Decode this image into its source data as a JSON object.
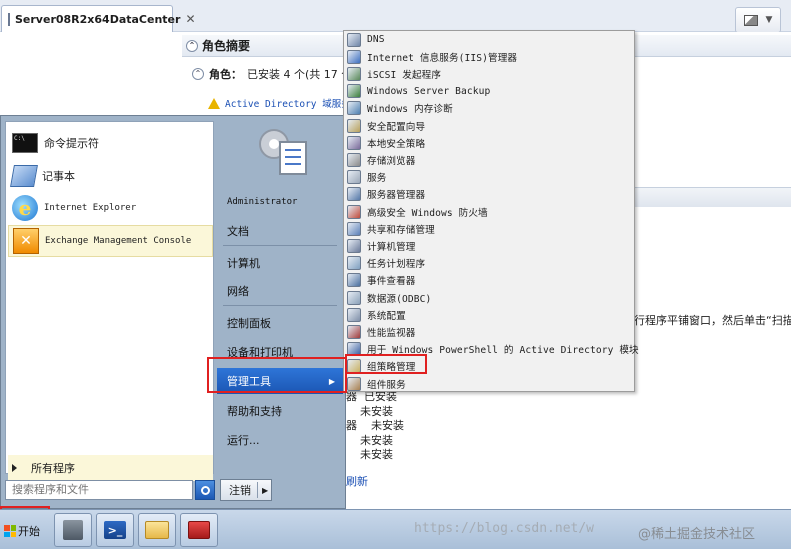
{
  "window": {
    "tab_title": "Server08R2x64DataCenter",
    "tab_close": "✕",
    "section_title": "角色摘要",
    "roles_label": "角色：",
    "roles_status": "已安装 4 个(共 17 个",
    "ad_link": "Active Directory 域服务",
    "right_text": "行程序平铺窗口，然后单击“扫描此",
    "status_lines": [
      "器  已安装",
      "    未安装",
      "器    未安装",
      "    未安装",
      "    未安装"
    ],
    "refresh_link": "刷新"
  },
  "start_menu": {
    "programs": [
      {
        "label": "命令提示符",
        "icon": "cmd-icon"
      },
      {
        "label": "记事本",
        "icon": "notepad-icon"
      },
      {
        "label": "Internet Explorer",
        "icon": "ie-icon"
      },
      {
        "label": "Exchange Management Console",
        "icon": "exchange-icon"
      }
    ],
    "all_programs": "所有程序",
    "search_placeholder": "搜索程序和文件",
    "right_items": [
      {
        "label": "Administrator"
      },
      {
        "label": "文档"
      },
      {
        "label": "计算机"
      },
      {
        "label": "网络"
      },
      {
        "label": "控制面板"
      },
      {
        "label": "设备和打印机"
      },
      {
        "label": "管理工具"
      },
      {
        "label": "帮助和支持"
      },
      {
        "label": "运行..."
      }
    ],
    "logoff_label": "注销",
    "selected_item": "管理工具"
  },
  "admin_tools": {
    "items": [
      "DNS",
      "Internet 信息服务(IIS)管理器",
      "iSCSI 发起程序",
      "Windows Server Backup",
      "Windows 内存诊断",
      "安全配置向导",
      "本地安全策略",
      "存储浏览器",
      "服务",
      "服务器管理器",
      "高级安全 Windows 防火墙",
      "共享和存储管理",
      "计算机管理",
      "任务计划程序",
      "事件查看器",
      "数据源(ODBC)",
      "系统配置",
      "性能监视器",
      "用于 Windows PowerShell 的 Active Directory 模块",
      "组策略管理",
      "组件服务"
    ],
    "highlighted": "组策略管理"
  },
  "taskbar": {
    "start_label": "开始",
    "pinned": [
      "server-manager-icon",
      "powershell-icon",
      "explorer-folder-icon",
      "toolbox-icon"
    ],
    "watermark": "https://blog.csdn.net/w",
    "watermark_brand": "@稀土掘金技术社区"
  },
  "colors": {
    "highlight_box": "#e02020",
    "selected_menu": "#1b56b3",
    "link": "#1a4fb4"
  }
}
